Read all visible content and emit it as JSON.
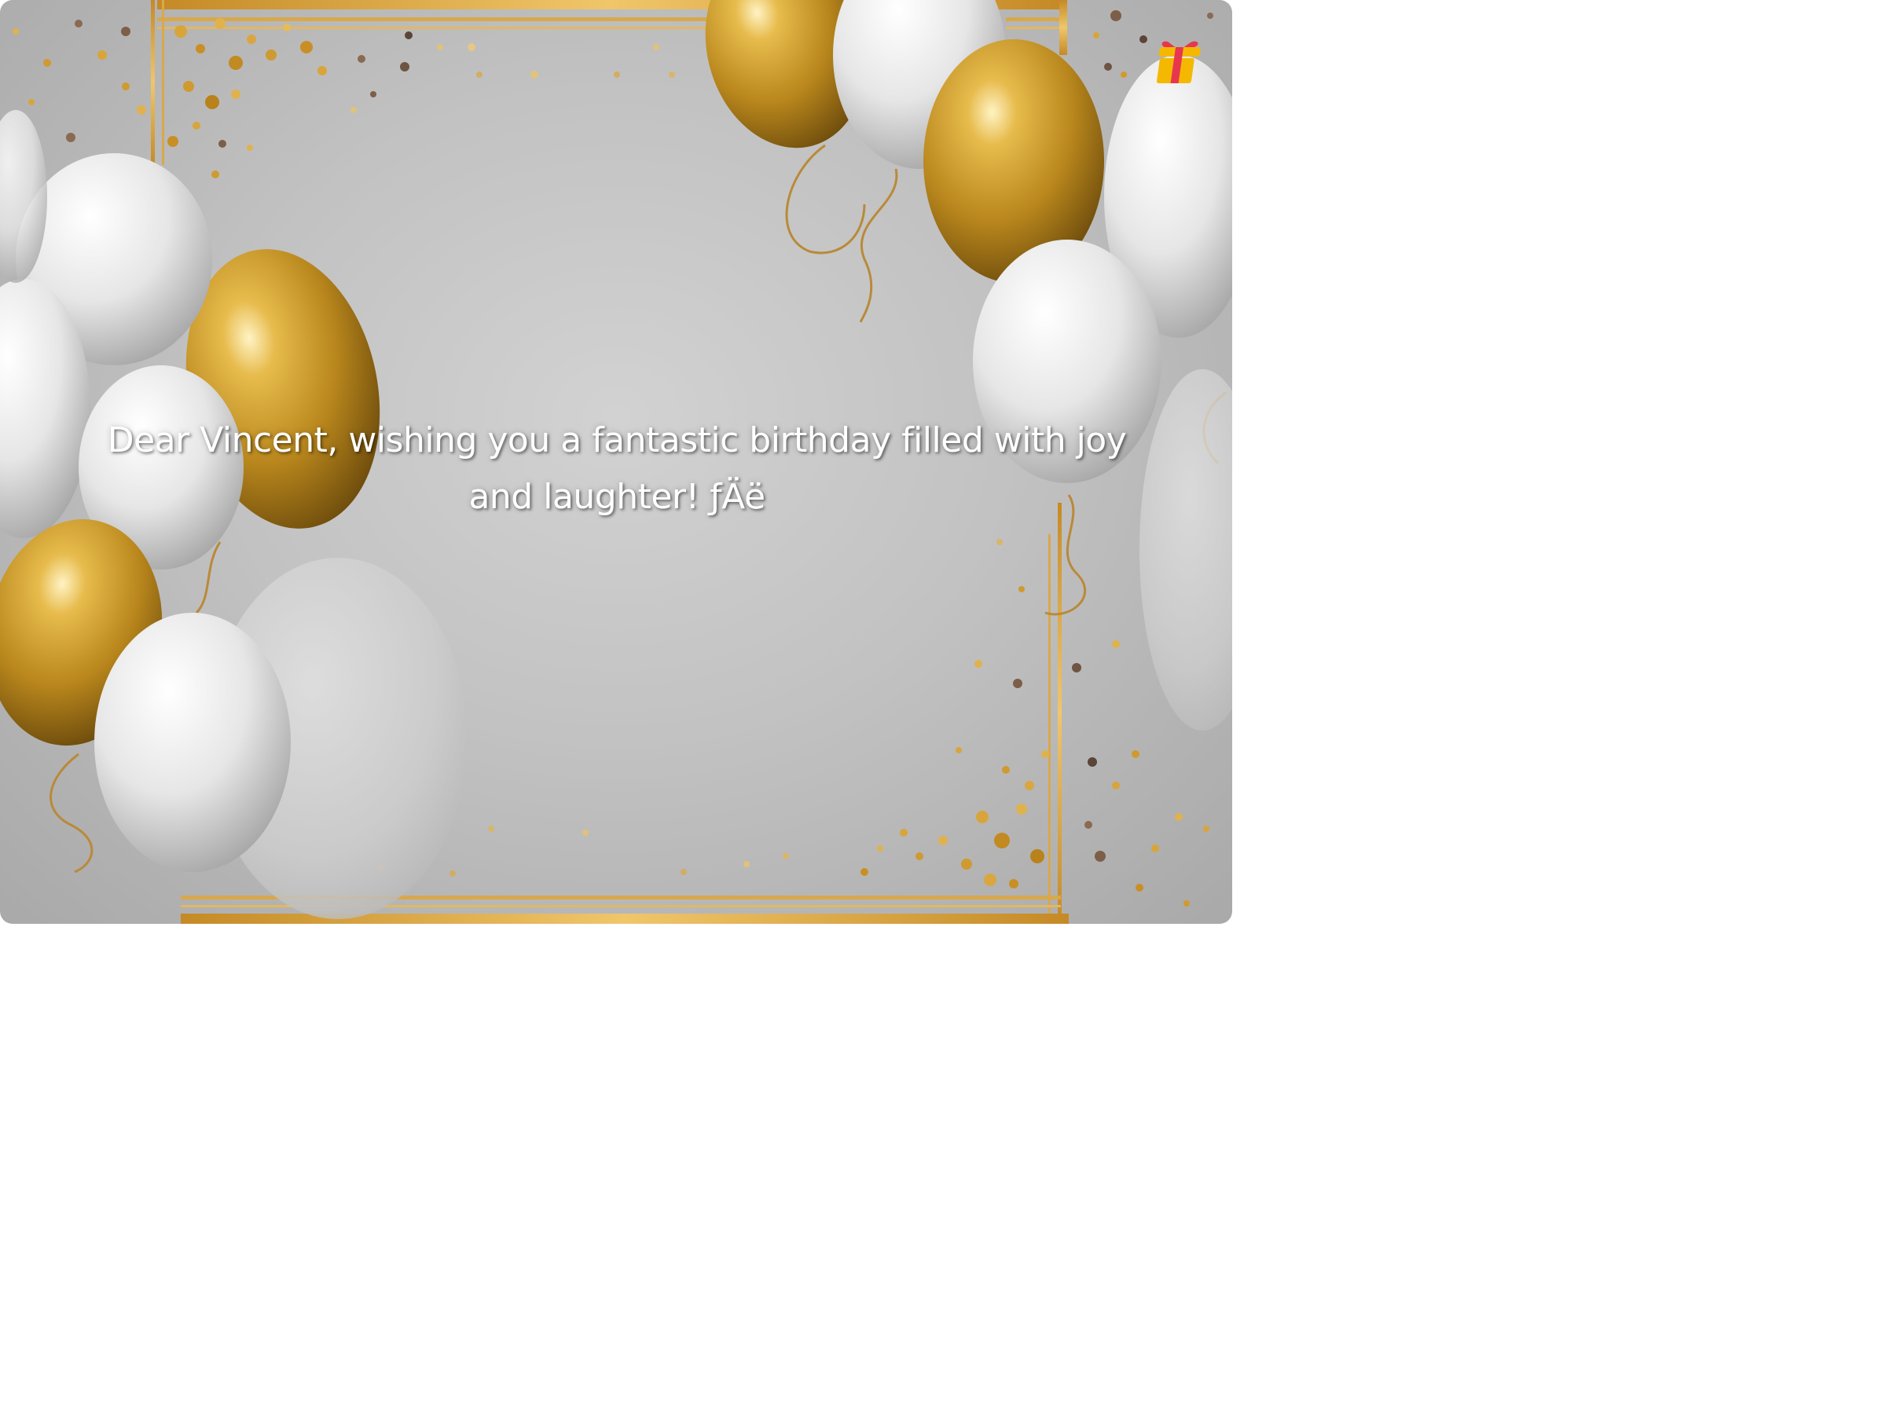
{
  "card": {
    "message": "Dear Vincent, wishing you a fantastic birthday filled with joy and laughter! ƒÄë"
  },
  "logo": {
    "icon": "gift-icon",
    "colors": [
      "#f5b800",
      "#e8364f"
    ]
  },
  "theme": {
    "balloon_gold": "#c9961f",
    "balloon_white": "#e9e9e9",
    "frame_gold": "#d4a23a",
    "background_gray": "#c4c4c4"
  }
}
